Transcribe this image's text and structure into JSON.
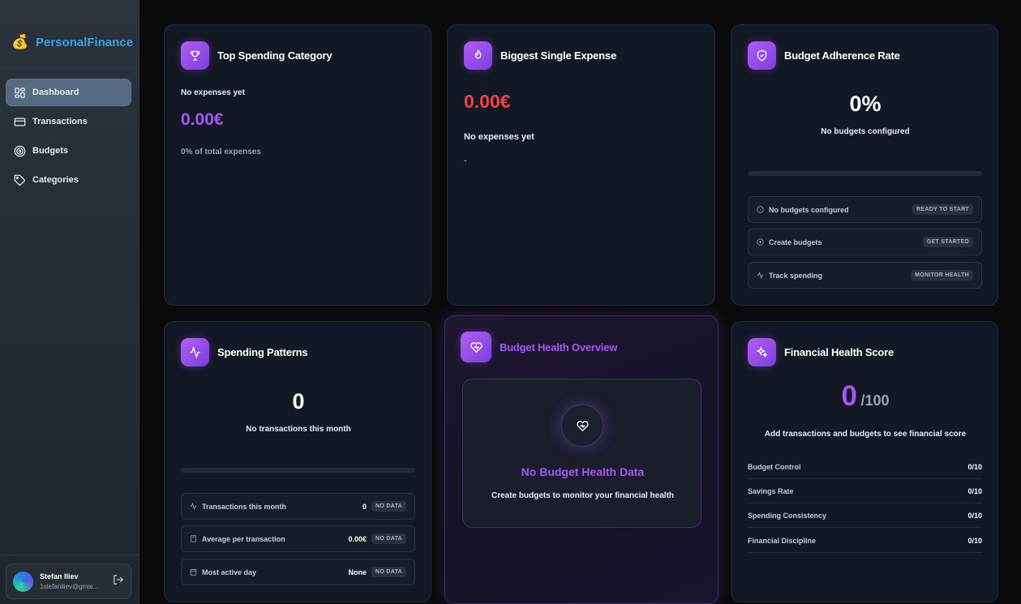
{
  "brand": {
    "icon": "money-bag",
    "name": "PersonalFinance"
  },
  "nav": [
    {
      "label": "Dashboard",
      "icon": "dashboard-icon",
      "active": true
    },
    {
      "label": "Transactions",
      "icon": "card-icon",
      "active": false
    },
    {
      "label": "Budgets",
      "icon": "target-icon",
      "active": false
    },
    {
      "label": "Categories",
      "icon": "tag-icon",
      "active": false
    }
  ],
  "user": {
    "name": "Stefan Iliev",
    "email": "1stefaniliev@gmai..."
  },
  "top_spending": {
    "title": "Top Spending Category",
    "subtitle": "No expenses yet",
    "amount": "0.00€",
    "share": "0% of total expenses"
  },
  "biggest_expense": {
    "title": "Biggest Single Expense",
    "amount": "0.00€",
    "subtitle": "No expenses yet",
    "detail": "-"
  },
  "budget_adherence": {
    "title": "Budget Adherence Rate",
    "rate": "0%",
    "subtitle": "No budgets configured",
    "progress": 0,
    "rows": [
      {
        "label": "No budgets configured",
        "badge": "READY TO START",
        "icon": "info-icon"
      },
      {
        "label": "Create budgets",
        "badge": "GET STARTED",
        "icon": "plus-circle-icon"
      },
      {
        "label": "Track spending",
        "badge": "MONITOR HEALTH",
        "icon": "activity-icon"
      }
    ]
  },
  "spending_patterns": {
    "title": "Spending Patterns",
    "count": "0",
    "subtitle": "No transactions this month",
    "progress": 0,
    "rows": [
      {
        "label": "Transactions this month",
        "value": "0",
        "badge": "NO DATA",
        "icon": "activity-icon"
      },
      {
        "label": "Average per transaction",
        "value": "0.00€",
        "badge": "NO DATA",
        "icon": "calculator-icon"
      },
      {
        "label": "Most active day",
        "value": "None",
        "badge": "NO DATA",
        "icon": "calendar-icon"
      }
    ]
  },
  "budget_health": {
    "title": "Budget Health Overview",
    "empty_title": "No Budget Health Data",
    "empty_text": "Create budgets to monitor your financial health"
  },
  "financial_health": {
    "title": "Financial Health Score",
    "score": "0",
    "max": "/100",
    "subtitle": "Add transactions and budgets to see financial score",
    "rows": [
      {
        "label": "Budget Control",
        "value": "0/10"
      },
      {
        "label": "Savings Rate",
        "value": "0/10"
      },
      {
        "label": "Spending Consistency",
        "value": "0/10"
      },
      {
        "label": "Financial Discipline",
        "value": "0/10"
      }
    ]
  },
  "colors": {
    "accent": "#a855f7",
    "negative": "#ef4444",
    "brand": "#3aa0e8"
  }
}
